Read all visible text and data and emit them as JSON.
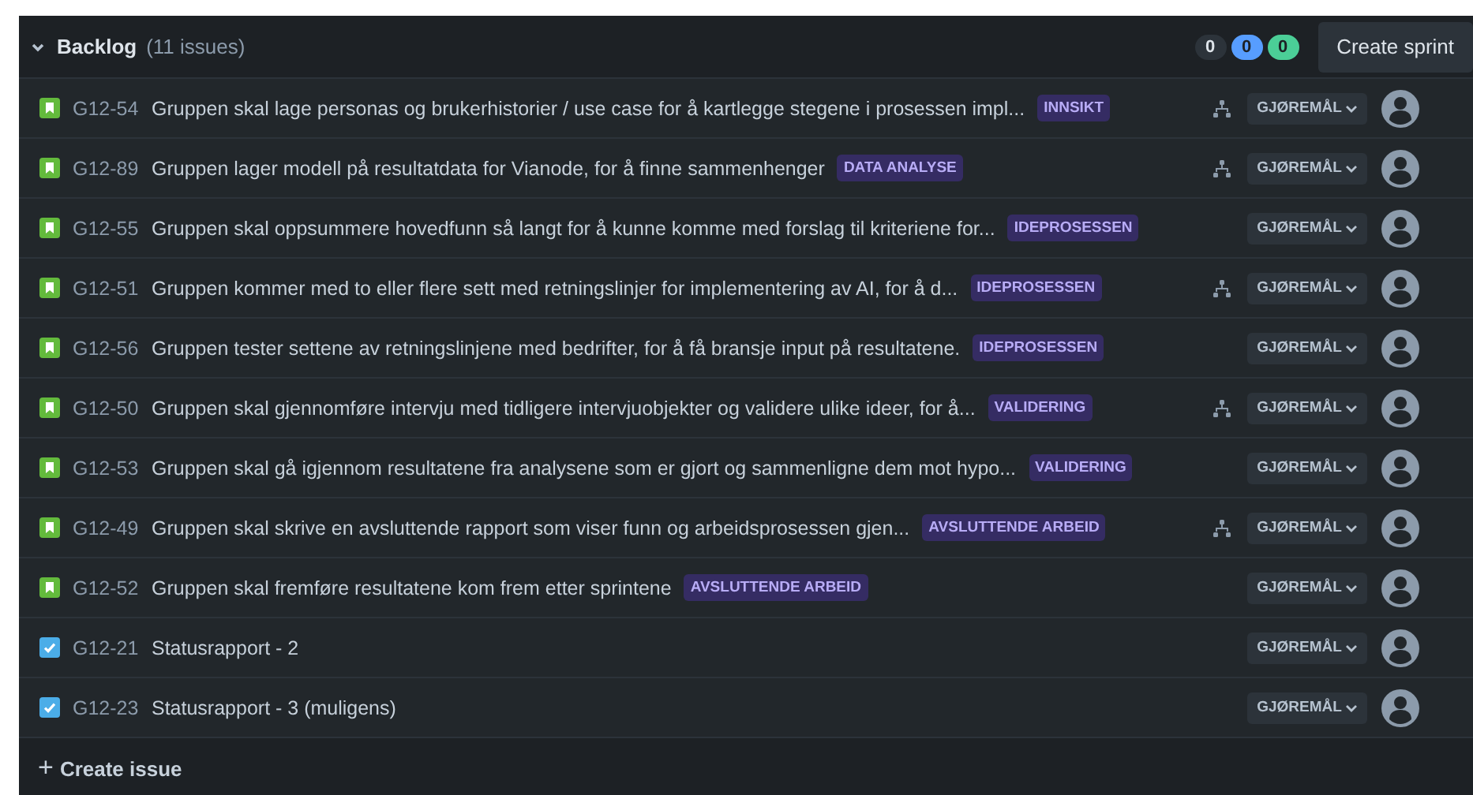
{
  "backlog": {
    "title": "Backlog",
    "count": "(11 issues)",
    "expanded": true,
    "counts": [
      {
        "value": "0",
        "color": "#2c333a"
      },
      {
        "value": "0",
        "color": "#579dff"
      },
      {
        "value": "0",
        "color": "#4bce97"
      }
    ],
    "create_sprint": "Create sprint"
  },
  "issues": [
    {
      "kind": "story",
      "key": "G12-54",
      "summary": "Gruppen skal lage personas og brukerhistorier / use case for å kartlegge stegene i prosessen impl...",
      "epic": "INNSIKT",
      "has_child_issues": true,
      "status": "GJØREMÅL"
    },
    {
      "kind": "story",
      "key": "G12-89",
      "summary": "Gruppen lager modell på resultatdata for Vianode, for å finne sammenhenger",
      "epic": "DATA ANALYSE",
      "has_child_issues": true,
      "status": "GJØREMÅL"
    },
    {
      "kind": "story",
      "key": "G12-55",
      "summary": "Gruppen skal oppsummere hovedfunn så langt for å kunne komme med forslag til kriteriene for...",
      "epic": "IDEPROSESSEN",
      "has_child_issues": false,
      "status": "GJØREMÅL"
    },
    {
      "kind": "story",
      "key": "G12-51",
      "summary": "Gruppen kommer med to eller flere sett med retningslinjer for implementering av AI, for å d...",
      "epic": "IDEPROSESSEN",
      "has_child_issues": true,
      "status": "GJØREMÅL"
    },
    {
      "kind": "story",
      "key": "G12-56",
      "summary": "Gruppen tester settene av retningslinjene med bedrifter, for å få bransje input på resultatene.",
      "epic": "IDEPROSESSEN",
      "has_child_issues": false,
      "status": "GJØREMÅL"
    },
    {
      "kind": "story",
      "key": "G12-50",
      "summary": "Gruppen skal gjennomføre intervju med tidligere intervjuobjekter og validere ulike ideer, for å...",
      "epic": "VALIDERING",
      "has_child_issues": true,
      "status": "GJØREMÅL"
    },
    {
      "kind": "story",
      "key": "G12-53",
      "summary": "Gruppen skal gå igjennom resultatene fra analysene som er gjort og sammenligne dem mot hypo...",
      "epic": "VALIDERING",
      "has_child_issues": false,
      "status": "GJØREMÅL"
    },
    {
      "kind": "story",
      "key": "G12-49",
      "summary": "Gruppen skal skrive en avsluttende rapport som viser funn og arbeidsprosessen gjen...",
      "epic": "AVSLUTTENDE ARBEID",
      "has_child_issues": true,
      "status": "GJØREMÅL"
    },
    {
      "kind": "story",
      "key": "G12-52",
      "summary": "Gruppen skal fremføre resultatene kom frem etter sprintene",
      "epic": "AVSLUTTENDE ARBEID",
      "has_child_issues": false,
      "status": "GJØREMÅL"
    },
    {
      "kind": "task",
      "key": "G12-21",
      "summary": "Statusrapport - 2",
      "has_child_issues": false,
      "status": "GJØREMÅL"
    },
    {
      "kind": "task",
      "key": "G12-23",
      "summary": "Statusrapport - 3 (muligens)",
      "has_child_issues": false,
      "status": "GJØREMÅL"
    }
  ],
  "create_issue": {
    "icon": "+",
    "label": "Create issue"
  }
}
